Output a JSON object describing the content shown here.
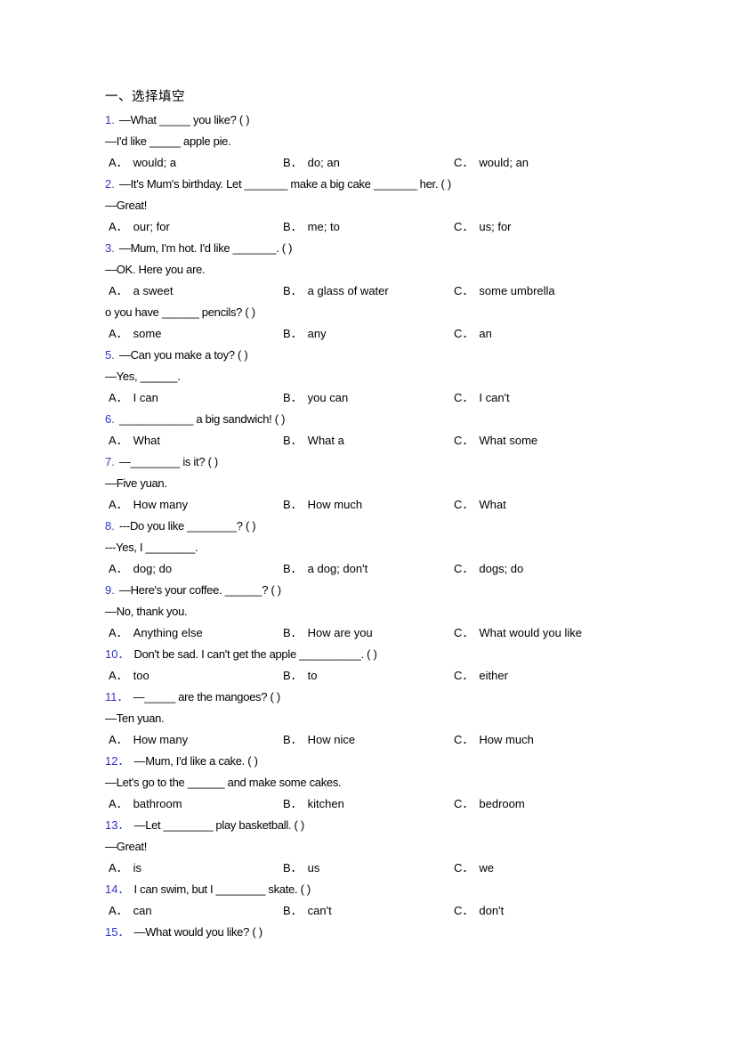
{
  "document": {
    "heading": "一、选择填空",
    "accent_color": "#3333cc",
    "text_color": "#000000",
    "background_color": "#ffffff"
  },
  "questions": [
    {
      "number": "1.",
      "lines": [
        "—What _____ you like? (   )",
        "—I'd like _____ apple pie."
      ],
      "options": [
        {
          "tag": "A．",
          "text": "would; a"
        },
        {
          "tag": "B．",
          "text": "do; an"
        },
        {
          "tag": "C．",
          "text": "would; an"
        }
      ]
    },
    {
      "number": "2.",
      "lines": [
        "—It's Mum's birthday. Let _______ make a big cake _______ her. (   )",
        "—Great!"
      ],
      "options": [
        {
          "tag": "A．",
          "text": "our; for"
        },
        {
          "tag": "B．",
          "text": "me; to"
        },
        {
          "tag": "C．",
          "text": "us; for"
        }
      ]
    },
    {
      "number": "3.",
      "lines": [
        "—Mum, I'm hot. I'd like _______. (   )",
        "—OK. Here you are."
      ],
      "options": [
        {
          "tag": "A．",
          "text": "a sweet"
        },
        {
          "tag": "B．",
          "text": "a glass of water"
        },
        {
          "tag": "C．",
          "text": "some umbrella"
        }
      ]
    },
    {
      "number": "",
      "lines": [
        "o you have ______ pencils? (   )"
      ],
      "options": [
        {
          "tag": "A．",
          "text": "some"
        },
        {
          "tag": "B．",
          "text": "any"
        },
        {
          "tag": "C．",
          "text": "an"
        }
      ]
    },
    {
      "number": "5.",
      "lines": [
        "—Can you make a toy? (   )",
        "—Yes, ______."
      ],
      "options": [
        {
          "tag": "A．",
          "text": "I can"
        },
        {
          "tag": "B．",
          "text": "you can"
        },
        {
          "tag": "C．",
          "text": "I can't"
        }
      ]
    },
    {
      "number": "6.",
      "lines": [
        "____________ a big sandwich! (   )"
      ],
      "options": [
        {
          "tag": "A．",
          "text": "What"
        },
        {
          "tag": "B．",
          "text": "What a"
        },
        {
          "tag": "C．",
          "text": "What some"
        }
      ]
    },
    {
      "number": "7.",
      "lines": [
        "—________ is it? (   )",
        "—Five yuan."
      ],
      "options": [
        {
          "tag": "A．",
          "text": "How many"
        },
        {
          "tag": "B．",
          "text": "How much"
        },
        {
          "tag": "C．",
          "text": "What"
        }
      ]
    },
    {
      "number": "8.",
      "lines": [
        "---Do you like ________? (   )",
        "---Yes, I ________."
      ],
      "options": [
        {
          "tag": "A．",
          "text": "dog; do"
        },
        {
          "tag": "B．",
          "text": "a dog; don't"
        },
        {
          "tag": "C．",
          "text": "dogs; do"
        }
      ]
    },
    {
      "number": "9.",
      "lines": [
        "—Here's your coffee. ______? (   )",
        "—No, thank you."
      ],
      "options": [
        {
          "tag": "A．",
          "text": "Anything else"
        },
        {
          "tag": "B．",
          "text": "How are you"
        },
        {
          "tag": "C．",
          "text": "What would you like"
        }
      ]
    },
    {
      "number": "10．",
      "lines": [
        "Don't be sad. I can't get the apple __________. (   )"
      ],
      "options": [
        {
          "tag": "A．",
          "text": "too"
        },
        {
          "tag": "B．",
          "text": "to"
        },
        {
          "tag": "C．",
          "text": "either"
        }
      ]
    },
    {
      "number": "11．",
      "lines": [
        "—_____ are the mangoes? (   )",
        "—Ten yuan."
      ],
      "options": [
        {
          "tag": "A．",
          "text": "How many"
        },
        {
          "tag": "B．",
          "text": "How nice"
        },
        {
          "tag": "C．",
          "text": "How much"
        }
      ]
    },
    {
      "number": "12．",
      "lines": [
        "—Mum, I'd like a cake. (   )",
        "—Let's go to the ______ and make some cakes."
      ],
      "options": [
        {
          "tag": "A．",
          "text": "bathroom"
        },
        {
          "tag": "B．",
          "text": "kitchen"
        },
        {
          "tag": "C．",
          "text": "bedroom"
        }
      ]
    },
    {
      "number": "13．",
      "lines": [
        "—Let ________ play basketball. (   )",
        "—Great!"
      ],
      "options": [
        {
          "tag": "A．",
          "text": "is"
        },
        {
          "tag": "B．",
          "text": "us"
        },
        {
          "tag": "C．",
          "text": "we"
        }
      ]
    },
    {
      "number": "14．",
      "lines": [
        "I can swim, but I ________ skate. (   )"
      ],
      "options": [
        {
          "tag": "A．",
          "text": "can"
        },
        {
          "tag": "B．",
          "text": "can't"
        },
        {
          "tag": "C．",
          "text": "don't"
        }
      ]
    },
    {
      "number": "15．",
      "lines": [
        "—What would you like? (   )"
      ],
      "options": []
    }
  ]
}
